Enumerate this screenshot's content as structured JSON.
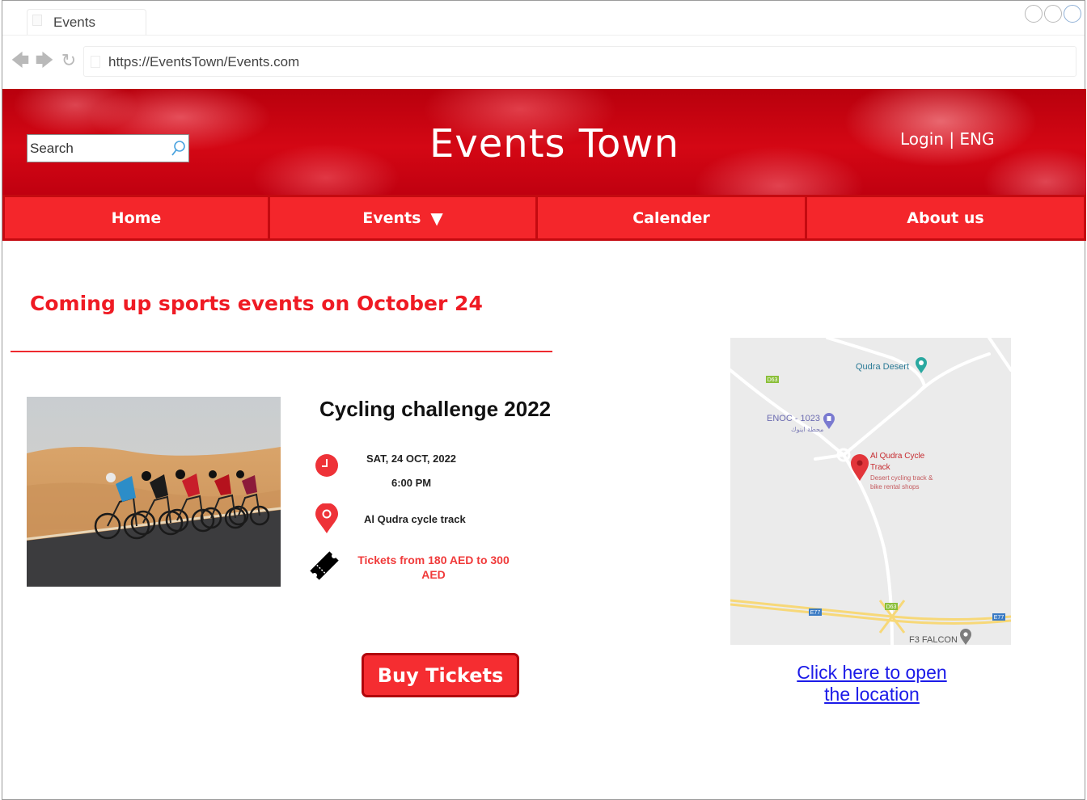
{
  "browser": {
    "tab_title": "Events",
    "url": "https://EventsTown/Events.com"
  },
  "header": {
    "search_placeholder": "Search",
    "site_title": "Events Town",
    "login_label": "Login | ENG"
  },
  "menu": {
    "items": [
      {
        "label": "Home"
      },
      {
        "label": "Events"
      },
      {
        "label": "Calender"
      },
      {
        "label": "About us"
      }
    ]
  },
  "main": {
    "headline": "Coming up sports events on October 24",
    "event": {
      "title": "Cycling challenge 2022",
      "date": "SAT, 24 OCT, 2022",
      "time": "6:00 PM",
      "location": "Al Qudra cycle track",
      "tickets": "Tickets from 180 AED to 300 AED"
    },
    "buy_button_label": "Buy Tickets",
    "map": {
      "labels": {
        "qudra_desert": "Qudra Desert",
        "enoc": "ENOC - 1023",
        "enoc_arabic": "محطة اينوك",
        "track_name_1": "Al Qudra Cycle",
        "track_name_2": "Track",
        "track_desc_1": "Desert cycling track &",
        "track_desc_2": "bike rental shops",
        "d63_top": "D63",
        "d63_bottom": "D63",
        "e77_left": "E77",
        "e77_right": "E77",
        "falcon": "F3 FALCON"
      }
    },
    "map_link": {
      "line1": "Click here to open",
      "line2": "the location"
    }
  },
  "colors": {
    "brand_red": "#f4262b",
    "dark_red": "#c40a10",
    "link_blue": "#1c1be8"
  }
}
